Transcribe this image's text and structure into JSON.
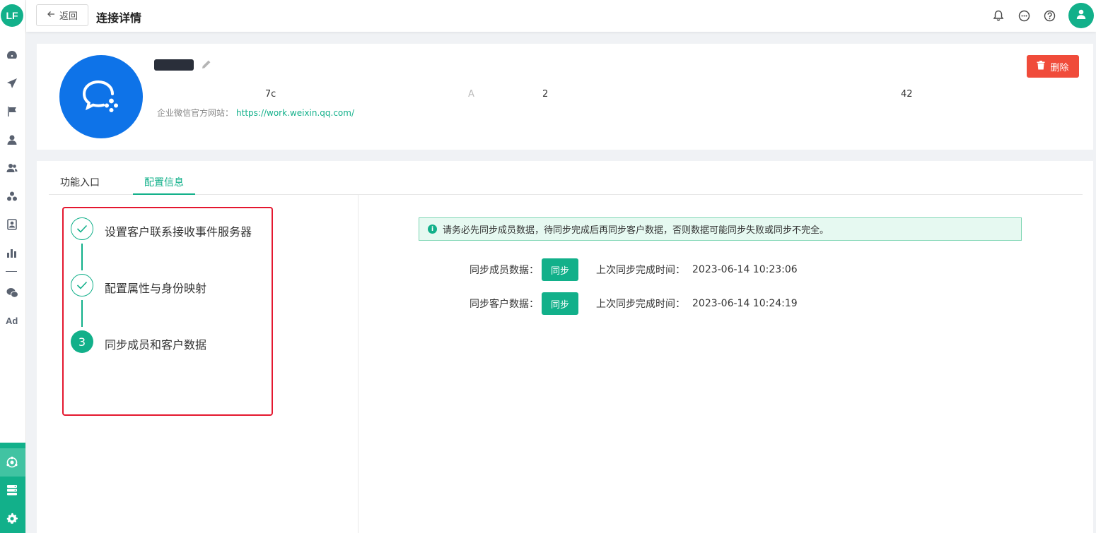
{
  "app": {
    "logo_text": "LF"
  },
  "topbar": {
    "back_label": "返回",
    "title": "连接详情",
    "icons": [
      "bell-icon",
      "message-icon",
      "help-icon",
      "user-icon"
    ]
  },
  "sidebar": {
    "items": [
      "dashboard-icon",
      "send-icon",
      "flag-icon",
      "user-icon",
      "users-icon",
      "segments-icon",
      "profile-icon",
      "chart-icon",
      "wechat-icon"
    ],
    "ad_label": "Ad",
    "bottom_items": [
      "integration-icon",
      "data-icon",
      "settings-icon"
    ]
  },
  "header": {
    "meta_1": "                                     7c",
    "meta_2": "A",
    "meta_3": "2",
    "meta_4": "42",
    "site_label": "企业微信官方网站：",
    "site_url": "https://work.weixin.qq.com/",
    "delete_label": "删除"
  },
  "tabs": [
    {
      "label": "功能入口"
    },
    {
      "label": "配置信息"
    }
  ],
  "steps": [
    {
      "label": "设置客户联系接收事件服务器",
      "status": "done"
    },
    {
      "label": "配置属性与身份映射",
      "status": "done"
    },
    {
      "label": "同步成员和客户数据",
      "status": "current",
      "number": "3"
    }
  ],
  "alert": {
    "text": "请务必先同步成员数据，待同步完成后再同步客户数据，否则数据可能同步失败或同步不完全。"
  },
  "sync": [
    {
      "label": "同步成员数据：",
      "button": "同步",
      "time_label": "上次同步完成时间：",
      "time": "2023-06-14 10:23:06"
    },
    {
      "label": "同步客户数据：",
      "button": "同步",
      "time_label": "上次同步完成时间：",
      "time": "2023-06-14 10:24:19"
    }
  ],
  "colors": {
    "primary": "#12b08a",
    "danger": "#f04b3a",
    "highlight": "#e4172f",
    "wecom_blue": "#0e73e8"
  }
}
